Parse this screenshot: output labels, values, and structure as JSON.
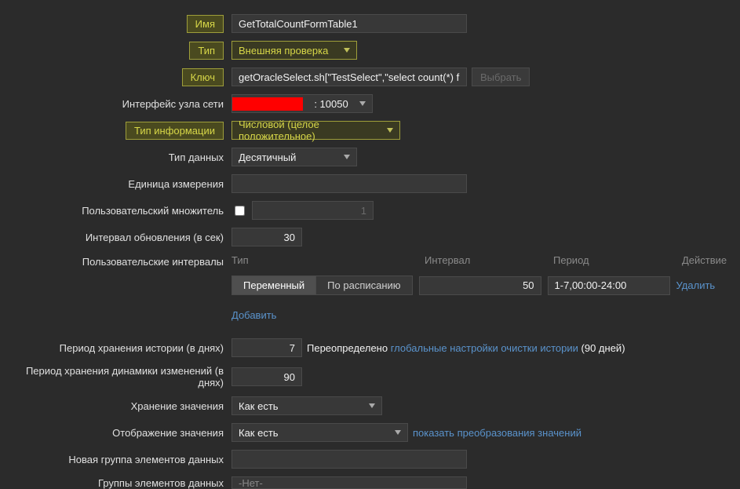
{
  "name": {
    "label": "Имя",
    "value": "GetTotalCountFormTable1"
  },
  "type": {
    "label": "Тип",
    "value": "Внешняя проверка"
  },
  "key": {
    "label": "Ключ",
    "value": "getOracleSelect.sh[\"TestSelect\",\"select count(*) from t",
    "select_btn": "Выбрать"
  },
  "interface": {
    "label": "Интерфейс узла сети",
    "port": ": 10050"
  },
  "info_type": {
    "label": "Тип информации",
    "value": "Числовой (целое положительное)"
  },
  "data_type": {
    "label": "Тип данных",
    "value": "Десятичный"
  },
  "unit": {
    "label": "Единица измерения",
    "value": ""
  },
  "multiplier": {
    "label": "Пользовательский множитель",
    "value": "1"
  },
  "update_interval": {
    "label": "Интервал обновления (в сек)",
    "value": "30"
  },
  "custom_intervals": {
    "label": "Пользовательские интервалы",
    "headers": {
      "type": "Тип",
      "interval": "Интервал",
      "period": "Период",
      "action": "Действие"
    },
    "row": {
      "toggle_flexible": "Переменный",
      "toggle_scheduled": "По расписанию",
      "interval": "50",
      "period": "1-7,00:00-24:00",
      "delete": "Удалить"
    },
    "add": "Добавить"
  },
  "history": {
    "label": "Период хранения истории (в днях)",
    "value": "7",
    "override_text": "Переопределено ",
    "link": "глобальные настройки очистки истории",
    "suffix": " (90 дней)"
  },
  "trends": {
    "label": "Период хранения динамики изменений (в днях)",
    "value": "90"
  },
  "store_value": {
    "label": "Хранение значения",
    "value": "Как есть"
  },
  "show_value": {
    "label": "Отображение значения",
    "value": "Как есть",
    "link": "показать преобразования значений"
  },
  "new_app": {
    "label": "Новая группа элементов данных",
    "value": ""
  },
  "apps": {
    "label": "Группы элементов данных",
    "value": "-Нет-"
  }
}
